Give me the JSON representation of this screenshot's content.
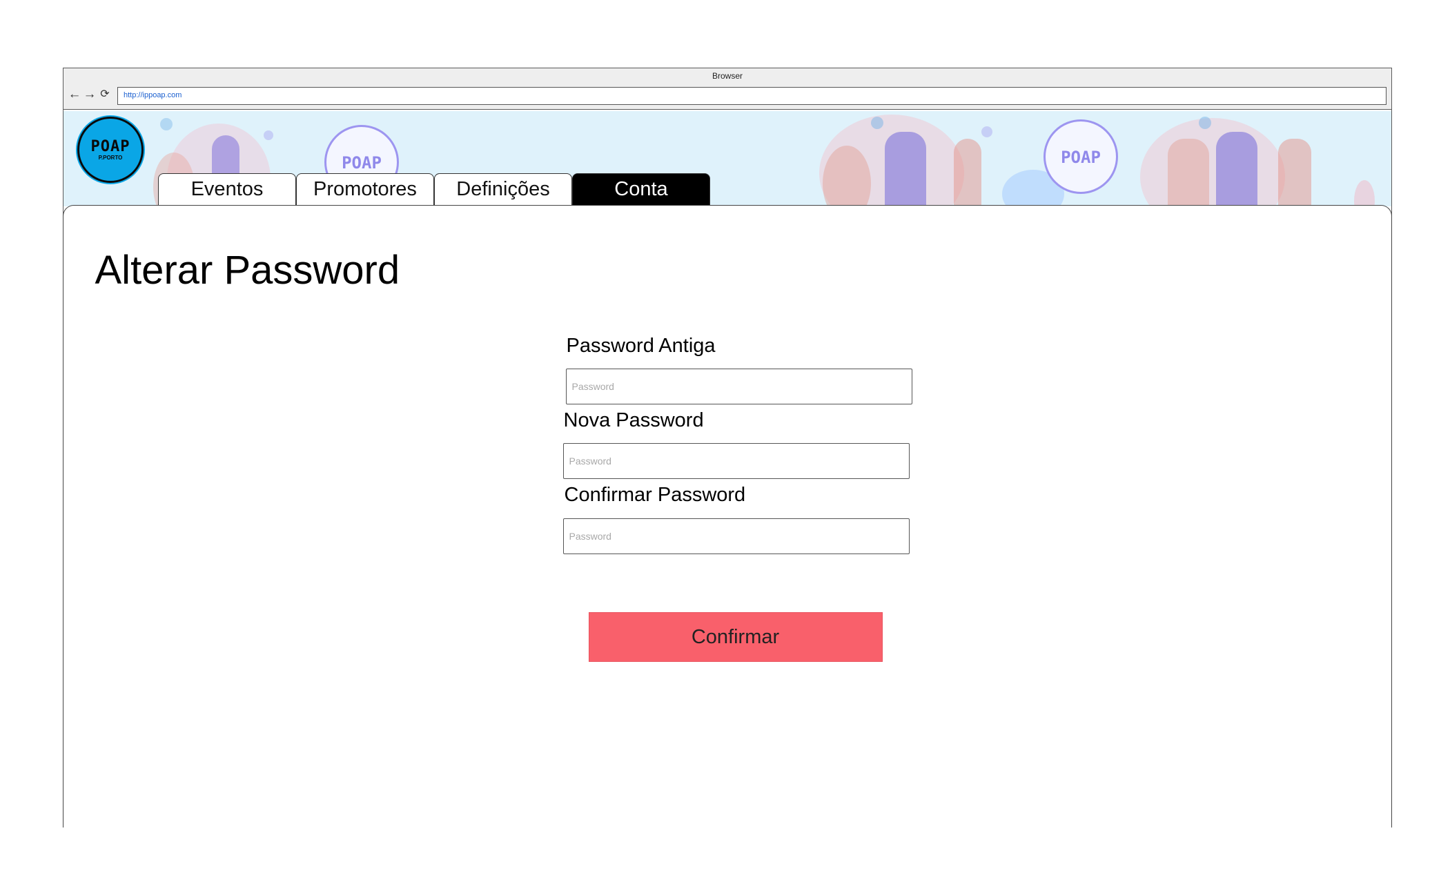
{
  "browser": {
    "title": "Browser",
    "url": "http://ippoap.com",
    "nav": {
      "back_icon": "←",
      "forward_icon": "→",
      "reload_icon": "⟳"
    }
  },
  "header": {
    "logo_main": "POAP",
    "logo_sub": "P.PORTO",
    "banner_badge": "POAP"
  },
  "tabs": [
    {
      "label": "Eventos",
      "active": false
    },
    {
      "label": "Promotores",
      "active": false
    },
    {
      "label": "Definições",
      "active": false
    },
    {
      "label": "Conta",
      "active": true
    }
  ],
  "main": {
    "title": "Alterar Password",
    "fields": [
      {
        "label": "Password Antiga",
        "placeholder": "Password",
        "value": ""
      },
      {
        "label": "Nova Password",
        "placeholder": "Password",
        "value": ""
      },
      {
        "label": "Confirmar Password",
        "placeholder": "Password",
        "value": ""
      }
    ],
    "confirm_label": "Confirmar"
  },
  "colors": {
    "accent_button": "#f9606b",
    "banner_bg": "#dff2fb",
    "logo_bg": "#0aa6e6",
    "active_tab": "#000000"
  }
}
